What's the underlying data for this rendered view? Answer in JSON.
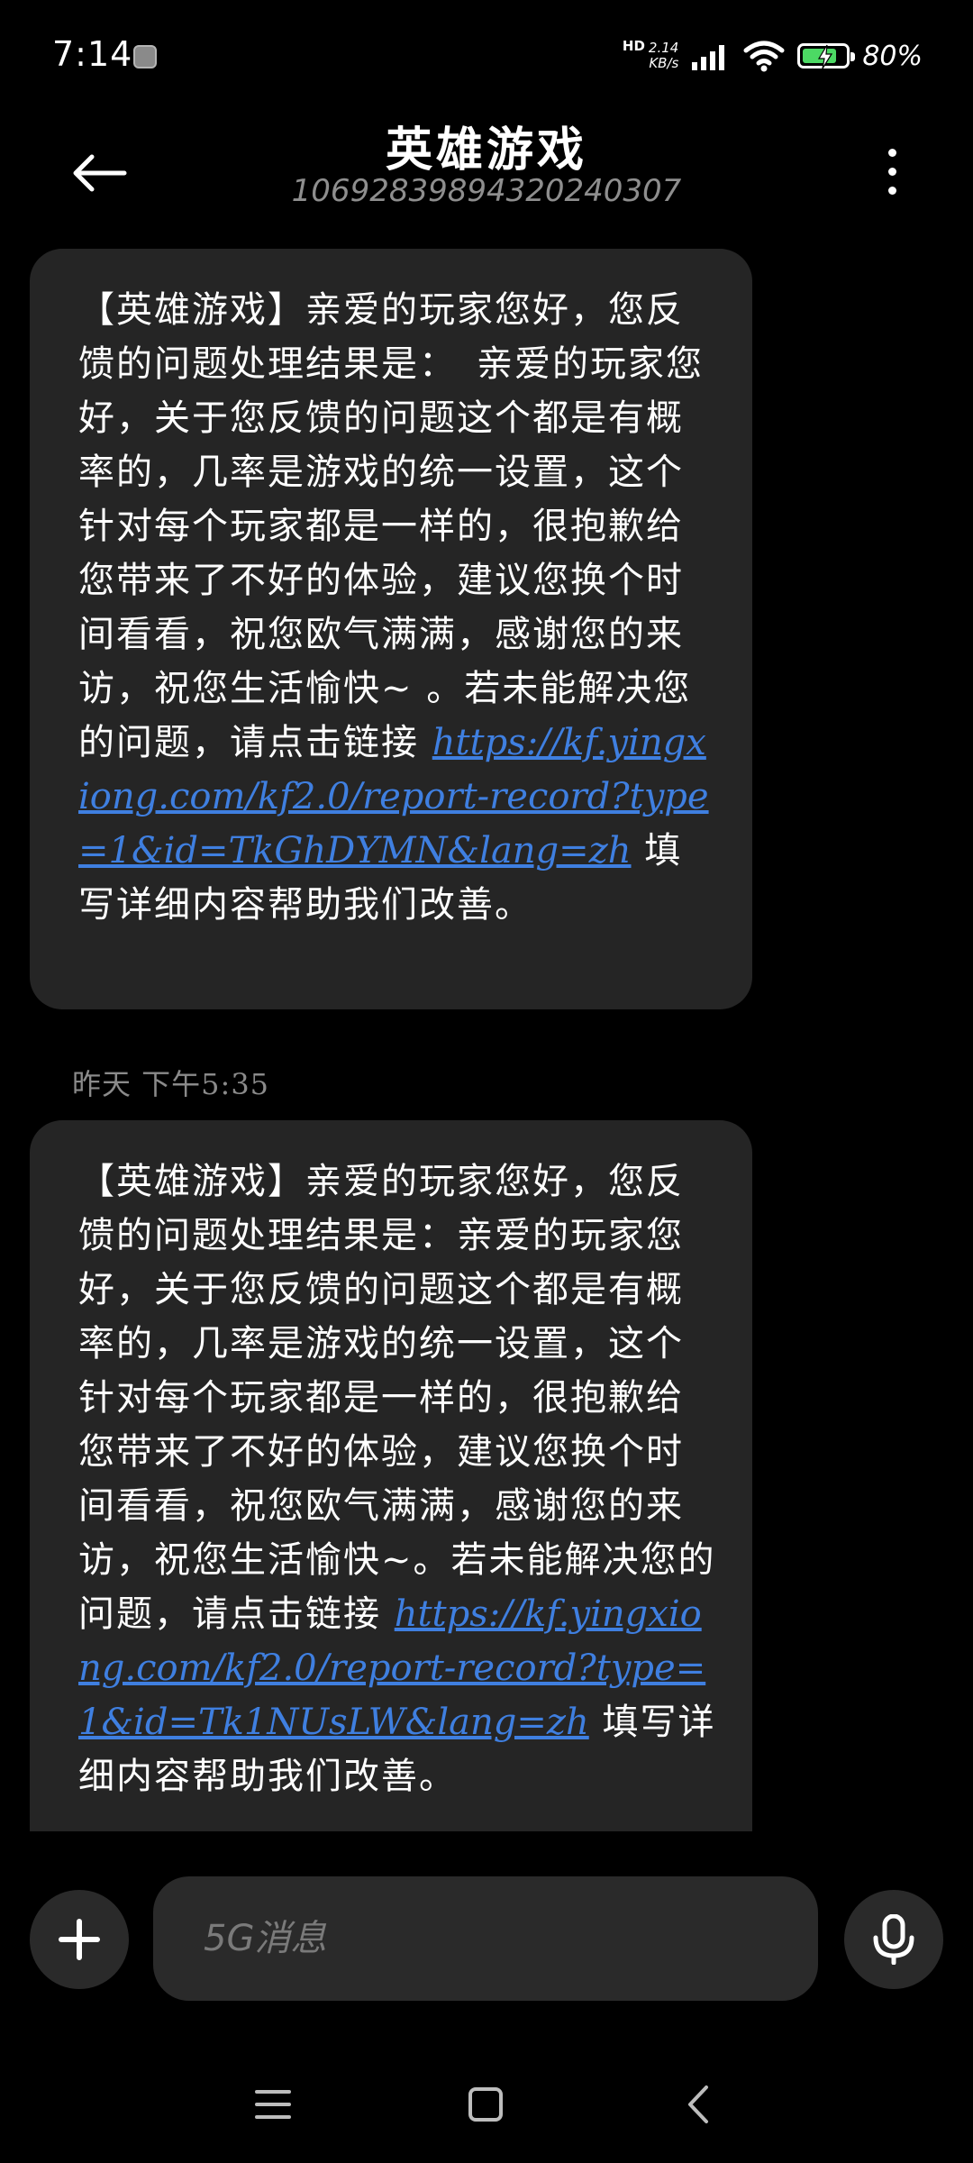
{
  "status_bar": {
    "time": "7:14",
    "net_speed_value": "2.14",
    "net_speed_unit": "KB/s",
    "hd_label": "HD",
    "battery_percent_text": "80%",
    "battery_level": 0.8,
    "icons": [
      "app-notification-icon",
      "signal-icon",
      "wifi-icon",
      "battery-charging-icon"
    ]
  },
  "header": {
    "title": "英雄游戏",
    "subtitle": "1069283989432024030​7",
    "back_icon": "arrow-left-icon",
    "more_icon": "more-vertical-icon"
  },
  "messages": [
    {
      "text_before_link": "【英雄游戏】亲爱的玩家您好，您反馈的问题处理结果是：　亲爱的玩家您好，关于您反馈的问题这个都是有概率的，几率是游戏的统一设置，这个针对每个玩家都是一样的，很抱歉给您带来了不好的体验，建议您换个时间看看，祝您欧气满满，感谢您的来访，祝您生活愉快~ 。若未能解决您的问题，请点击链接 ",
      "link": "https://kf.yingxiong.com/kf2.0/report-record?type=1&id=TkGhDYMN&lang=zh",
      "text_after_link": " 填写详细内容帮助我们改善。"
    },
    {
      "text_before_link": "【英雄游戏】亲爱的玩家您好，您反馈的问题处理结果是：亲爱的玩家您好，关于您反馈的问题这个都是有概率的，几率是游戏的统一设置，这个针对每个玩家都是一样的，很抱歉给您带来了不好的体验，建议您换个时间看看，祝您欧气满满，感谢您的来访，祝您生活愉快~。若未能解决您的问题，请点击链接 ",
      "link": "https://kf.yingxiong.com/kf2.0/report-record?type=1&id=Tk1NUsLW&lang=zh",
      "text_after_link": " 填写详细内容帮助我们改善。"
    }
  ],
  "timestamp": "昨天 下午5:35",
  "composer": {
    "placeholder": "5G消息",
    "add_icon": "plus-icon",
    "mic_icon": "microphone-icon"
  },
  "nav_bar": {
    "icons": [
      "menu-icon",
      "home-icon",
      "back-icon"
    ]
  },
  "colors": {
    "background": "#000000",
    "bubble": "#252525",
    "link": "#3f7fe0",
    "battery": "#4cd964"
  }
}
